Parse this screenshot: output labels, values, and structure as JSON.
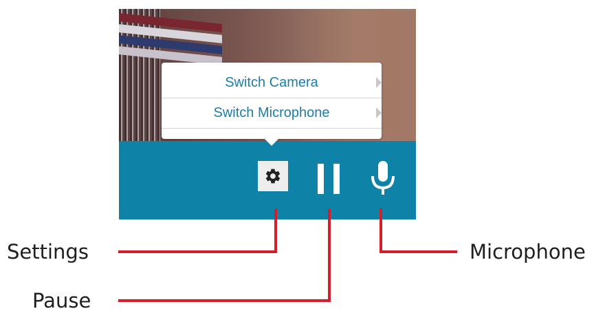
{
  "menu": {
    "items": [
      {
        "label": "Switch Camera"
      },
      {
        "label": "Switch Microphone"
      }
    ]
  },
  "controls": {
    "settings": {
      "icon": "gear-icon"
    },
    "pause": {
      "icon": "pause-icon"
    },
    "microphone": {
      "icon": "microphone-icon"
    }
  },
  "callouts": {
    "settings": "Settings",
    "pause": "Pause",
    "microphone": "Microphone"
  },
  "colors": {
    "control_bar": "#0f82a8",
    "menu_text": "#1a7ea8",
    "callout_line": "#d41f2a",
    "settings_button_bg": "#eeeeee"
  }
}
